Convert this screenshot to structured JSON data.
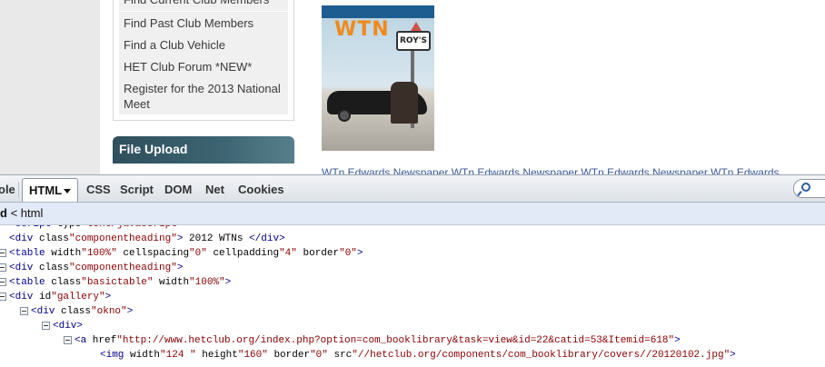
{
  "page": {
    "menu_items": [
      "Find Current Club Members",
      "Find Past Club Members",
      "Find a Club Vehicle",
      "HET Club Forum *NEW*",
      "Register for the 2013 National Meet"
    ],
    "file_upload_title": "File Upload",
    "cover": {
      "title": "WTN",
      "sign_text": "ROY'S"
    },
    "cut_links_text": "WTn Edwards Newspaper   WTn Edwards Newspaper   WTn Edwards Newspaper   WTn Edwards"
  },
  "firebug": {
    "tabs": [
      "ole",
      "HTML",
      "CSS",
      "Script",
      "DOM",
      "Net",
      "Cookies"
    ],
    "active_tab": "HTML",
    "breadcrumb": {
      "current": "d",
      "separator": "<",
      "parent": "html"
    },
    "tree": [
      {
        "indent": 0,
        "toggle": false,
        "pre": "<script type=\"",
        "tag": "",
        "text": "text/javascript\" >",
        "raw": "<script type=\"text/javascript\" >"
      },
      {
        "indent": 0,
        "toggle": false,
        "raw": "<div class=\"componentheading\"> 2012 WTNs </div>"
      },
      {
        "indent": 0,
        "toggle": true,
        "raw": "<table width=\"100%\" cellspacing=\"0\" cellpadding=\"4\" border=\"0\">"
      },
      {
        "indent": 0,
        "toggle": true,
        "raw": "<div class=\"componentheading\">"
      },
      {
        "indent": 0,
        "toggle": true,
        "raw": "<table class=\"basictable\" width=\"100%\">"
      },
      {
        "indent": 0,
        "toggle": true,
        "raw": "<div id=\"gallery\">"
      },
      {
        "indent": 1,
        "toggle": true,
        "raw": "<div class=\"okno\">"
      },
      {
        "indent": 2,
        "toggle": true,
        "raw": "<div>"
      },
      {
        "indent": 3,
        "toggle": true,
        "raw": "<a href=\"http://www.hetclub.org/index.php?option=com_booklibrary&task=view&id=22&catid=53&Itemid=618\">"
      },
      {
        "indent": 4,
        "toggle": false,
        "raw": "<img width=\"124 \" height=\"160\" border=\"0\" src=\"//hetclub.org/components/com_booklibrary/covers//20120102.jpg\">"
      }
    ]
  }
}
